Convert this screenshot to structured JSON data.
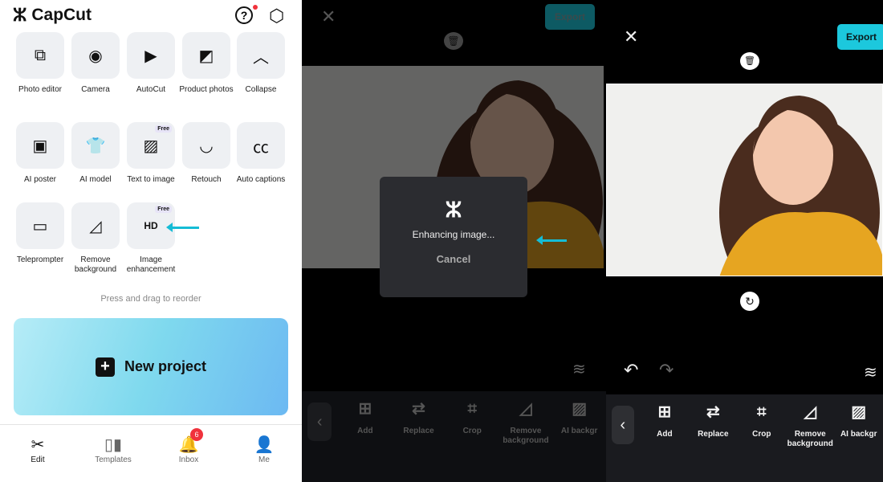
{
  "home": {
    "app_name": "CapCut",
    "tools": [
      {
        "label": "Photo editor",
        "icon": "photo-editor-icon",
        "glyph": "⧉"
      },
      {
        "label": "Camera",
        "icon": "camera-icon",
        "glyph": "◉"
      },
      {
        "label": "AutoCut",
        "icon": "autocut-icon",
        "glyph": "▶"
      },
      {
        "label": "Product photos",
        "icon": "product-photos-icon",
        "glyph": "◩"
      },
      {
        "label": "Collapse",
        "icon": "chevron-up-icon",
        "glyph": "︿"
      },
      {
        "label": "AI poster",
        "icon": "ai-poster-icon",
        "glyph": "▣"
      },
      {
        "label": "AI model",
        "icon": "ai-model-icon",
        "glyph": "👕"
      },
      {
        "label": "Text to image",
        "icon": "text-to-image-icon",
        "glyph": "▨",
        "badge": "Free"
      },
      {
        "label": "Retouch",
        "icon": "retouch-icon",
        "glyph": "◡"
      },
      {
        "label": "Auto captions",
        "icon": "captions-icon",
        "glyph": "㏄"
      },
      {
        "label": "Teleprompter",
        "icon": "teleprompter-icon",
        "glyph": "▭"
      },
      {
        "label": "Remove background",
        "icon": "remove-background-icon",
        "glyph": "◿"
      },
      {
        "label": "Image enhancement",
        "icon": "hd-icon",
        "glyph": "HD",
        "badge": "Free"
      }
    ],
    "hint": "Press and drag to reorder",
    "new_project": "New project",
    "nav": [
      {
        "label": "Edit",
        "glyph": "✂"
      },
      {
        "label": "Templates",
        "glyph": "▯▮"
      },
      {
        "label": "Inbox",
        "glyph": "🔔",
        "badge": "6"
      },
      {
        "label": "Me",
        "glyph": "👤"
      }
    ]
  },
  "editor_processing": {
    "export": "Export",
    "dialog_text": "Enhancing image...",
    "cancel": "Cancel"
  },
  "editor_done": {
    "export": "Export"
  },
  "toolbar": [
    {
      "label": "Add",
      "glyph": "⊞"
    },
    {
      "label": "Replace",
      "glyph": "⇄"
    },
    {
      "label": "Crop",
      "glyph": "⌗"
    },
    {
      "label": "Remove background",
      "glyph": "◿"
    },
    {
      "label": "AI backgr",
      "glyph": "▨"
    }
  ],
  "colors": {
    "accent": "#1cc8dd",
    "arrow": "#15bcd6",
    "badge": "#f0323c"
  }
}
